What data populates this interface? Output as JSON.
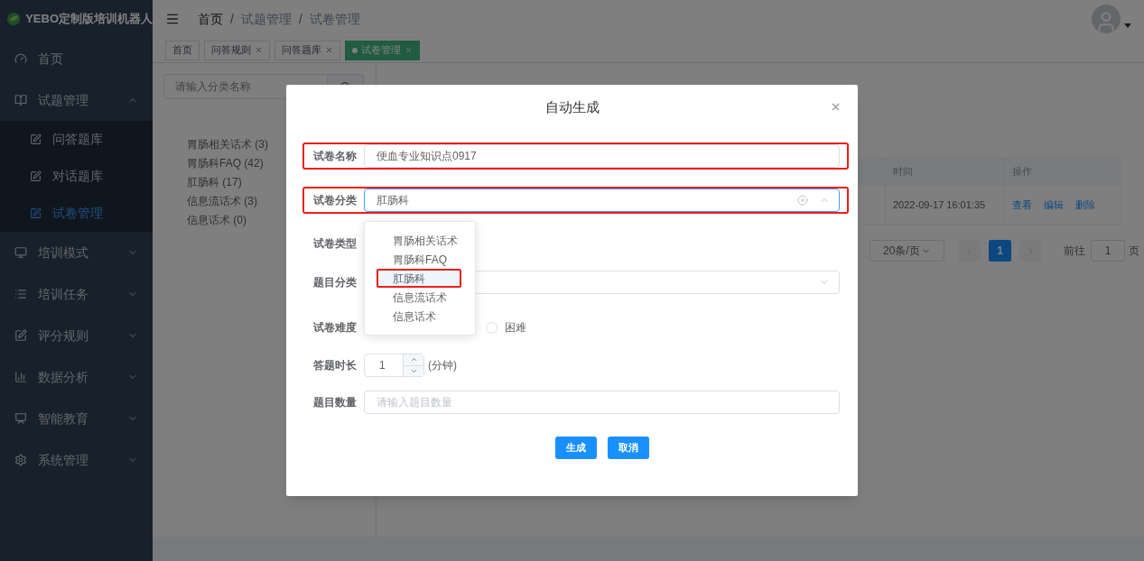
{
  "sidebar": {
    "title": "YEBO定制版培训机器人",
    "items": [
      {
        "kind": "link",
        "label": "首页"
      },
      {
        "kind": "group",
        "label": "试题管理",
        "expanded": true,
        "children": [
          {
            "label": "问答题库",
            "selected": false
          },
          {
            "label": "对话题库",
            "selected": false
          },
          {
            "label": "试卷管理",
            "selected": true
          }
        ]
      },
      {
        "kind": "group",
        "label": "培训模式",
        "expanded": false
      },
      {
        "kind": "group",
        "label": "培训任务",
        "expanded": false
      },
      {
        "kind": "group",
        "label": "评分规则",
        "expanded": false
      },
      {
        "kind": "group",
        "label": "数据分析",
        "expanded": false
      },
      {
        "kind": "group",
        "label": "智能教育",
        "expanded": false
      },
      {
        "kind": "group",
        "label": "系统管理",
        "expanded": false
      }
    ]
  },
  "breadcrumb": [
    {
      "label": "首页"
    },
    {
      "separator": "/",
      "label": "试题管理"
    },
    {
      "separator": "/",
      "label": "试卷管理"
    }
  ],
  "tabs": [
    {
      "label": "首页",
      "selected": false,
      "closable": false
    },
    {
      "label": "问答规则",
      "selected": false,
      "closable": true
    },
    {
      "label": "问答题库",
      "selected": false,
      "closable": true
    },
    {
      "label": "试卷管理",
      "selected": true,
      "closable": true
    }
  ],
  "category_panel": {
    "search": {
      "placeholder": "请输入分类名称"
    },
    "categories": [
      "胃肠相关话术 (3)",
      "胃肠科FAQ (42)",
      "肛肠科 (17)",
      "信息流话术 (3)",
      "信息话术 (0)"
    ]
  },
  "table": {
    "columns": [
      "时间",
      "操作"
    ],
    "rows": [
      {
        "cells": [
          "2022-09-17 16:01:35"
        ],
        "actions": [
          "查看",
          "编辑",
          "删除"
        ]
      }
    ]
  },
  "pagination": {
    "page_size": "20条/页",
    "pages": [
      {
        "label": "1",
        "selected": true
      }
    ],
    "goto_label": "前往",
    "goto_value": "1",
    "page_suffix": "页"
  },
  "dialog": {
    "title": "自动生成",
    "fields": [
      {
        "kind": "text",
        "label": "试卷名称",
        "value": "便血专业知识点0917",
        "annotated": true
      },
      {
        "kind": "select",
        "label": "试卷分类",
        "value": "肛肠科",
        "focused": true,
        "open": true,
        "annotated": true,
        "options": [
          {
            "label": "胃肠相关话术",
            "selected": false,
            "annotated": false
          },
          {
            "label": "胃肠科FAQ",
            "selected": false,
            "annotated": false
          },
          {
            "label": "肛肠科",
            "selected": true,
            "annotated": true
          },
          {
            "label": "信息流话术",
            "selected": false,
            "annotated": false
          },
          {
            "label": "信息话术",
            "selected": false,
            "annotated": false
          }
        ]
      },
      {
        "kind": "blank",
        "label": "试卷类型"
      },
      {
        "kind": "select",
        "label": "题目分类",
        "focused": false,
        "open": false,
        "annotated": false
      },
      {
        "kind": "radio",
        "label": "试卷难度",
        "options": [
          {
            "label": "困难",
            "selected": false
          }
        ]
      },
      {
        "kind": "number",
        "label": "答题时长",
        "value": "1",
        "unit": "(分钟)"
      },
      {
        "kind": "text",
        "label": "题目数量",
        "placeholder": "请输入题目数量",
        "annotated": false
      }
    ],
    "buttons": [
      "生成",
      "取消"
    ]
  }
}
